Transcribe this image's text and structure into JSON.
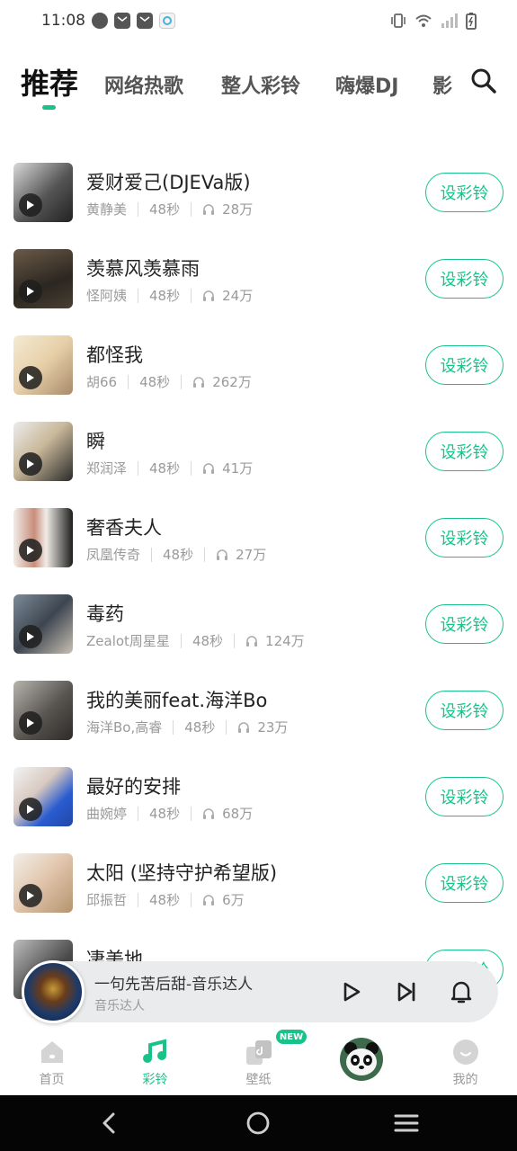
{
  "status_bar": {
    "time": "11:08"
  },
  "tabs": [
    {
      "label": "推荐",
      "active": true
    },
    {
      "label": "网络热歌",
      "active": false
    },
    {
      "label": "整人彩铃",
      "active": false
    },
    {
      "label": "嗨爆DJ",
      "active": false
    },
    {
      "label": "影",
      "active": false
    }
  ],
  "search_icon": "search-icon",
  "songs": [
    {
      "title": "爱财爱己(DJEVa版)",
      "artist": "黄静美",
      "duration": "48秒",
      "plays": "28万",
      "button": "设彩铃"
    },
    {
      "title": "羡慕风羡慕雨",
      "artist": "怪阿姨",
      "duration": "48秒",
      "plays": "24万",
      "button": "设彩铃"
    },
    {
      "title": "都怪我",
      "artist": "胡66",
      "duration": "48秒",
      "plays": "262万",
      "button": "设彩铃"
    },
    {
      "title": "瞬",
      "artist": "郑润泽",
      "duration": "48秒",
      "plays": "41万",
      "button": "设彩铃"
    },
    {
      "title": "奢香夫人",
      "artist": "凤凰传奇",
      "duration": "48秒",
      "plays": "27万",
      "button": "设彩铃"
    },
    {
      "title": "毒药",
      "artist": "Zealot周星星",
      "duration": "48秒",
      "plays": "124万",
      "button": "设彩铃"
    },
    {
      "title": "我的美丽feat.海洋Bo",
      "artist": "海洋Bo,高睿",
      "duration": "48秒",
      "plays": "23万",
      "button": "设彩铃"
    },
    {
      "title": "最好的安排",
      "artist": "曲婉婷",
      "duration": "48秒",
      "plays": "68万",
      "button": "设彩铃"
    },
    {
      "title": "太阳 (坚持守护希望版)",
      "artist": "邱振哲",
      "duration": "48秒",
      "plays": "6万",
      "button": "设彩铃"
    },
    {
      "title": "凄美地",
      "artist": "",
      "duration": "",
      "plays": "",
      "button": "设彩铃"
    }
  ],
  "player": {
    "title": "一句先苦后甜-音乐达人",
    "artist": "音乐达人"
  },
  "bottom_nav": [
    {
      "label": "首页",
      "icon": "home-icon",
      "active": false
    },
    {
      "label": "彩铃",
      "icon": "music-note-icon",
      "active": true
    },
    {
      "label": "壁纸",
      "icon": "wallpaper-icon",
      "active": false,
      "badge": "NEW"
    },
    {
      "label": "",
      "icon": "panda-avatar",
      "active": false
    },
    {
      "label": "我的",
      "icon": "profile-icon",
      "active": false
    }
  ],
  "colors": {
    "accent": "#19c28b",
    "player_bg": "#e9ebed"
  }
}
